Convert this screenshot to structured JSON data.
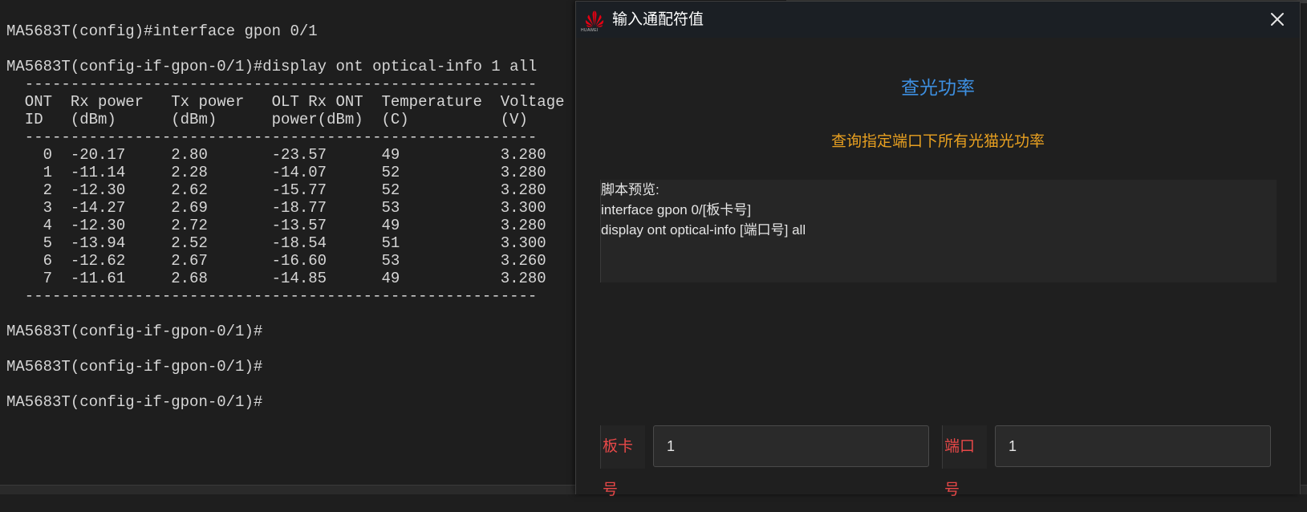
{
  "terminal": {
    "lines": [
      "MA5683T(config)#interface gpon 0/1",
      "",
      "MA5683T(config-if-gpon-0/1)#display ont optical-info 1 all",
      "  --------------------------------------------------------",
      "  ONT  Rx power   Tx power   OLT Rx ONT  Temperature  Voltage",
      "  ID   (dBm)      (dBm)      power(dBm)  (C)          (V)",
      "  --------------------------------------------------------",
      "    0  -20.17     2.80       -23.57      49           3.280",
      "    1  -11.14     2.28       -14.07      52           3.280",
      "    2  -12.30     2.62       -15.77      52           3.280",
      "    3  -14.27     2.69       -18.77      53           3.300",
      "    4  -12.30     2.72       -13.57      49           3.280",
      "    5  -13.94     2.52       -18.54      51           3.300",
      "    6  -12.62     2.67       -16.60      53           3.260",
      "    7  -11.61     2.68       -14.85      49           3.280",
      "  --------------------------------------------------------",
      "",
      "MA5683T(config-if-gpon-0/1)#",
      "",
      "MA5683T(config-if-gpon-0/1)#",
      "",
      "MA5683T(config-if-gpon-0/1)#"
    ]
  },
  "dialog": {
    "title": "输入通配符值",
    "logo_text": "HUAWEI",
    "heading": "查光功率",
    "description": "查询指定端口下所有光猫光功率",
    "preview": {
      "label": "脚本预览:",
      "lines": [
        "interface gpon 0/[板卡号]",
        "display ont optical-info [端口号] all"
      ]
    },
    "params": [
      {
        "label": "板卡号",
        "value": "1"
      },
      {
        "label": "端口号",
        "value": "1"
      }
    ]
  },
  "colors": {
    "heading": "#3d8fe0",
    "description": "#e8a020",
    "param_label": "#e84848",
    "huawei_red": "#e60012"
  },
  "icons": [
    "huawei-logo-icon",
    "close-icon"
  ]
}
